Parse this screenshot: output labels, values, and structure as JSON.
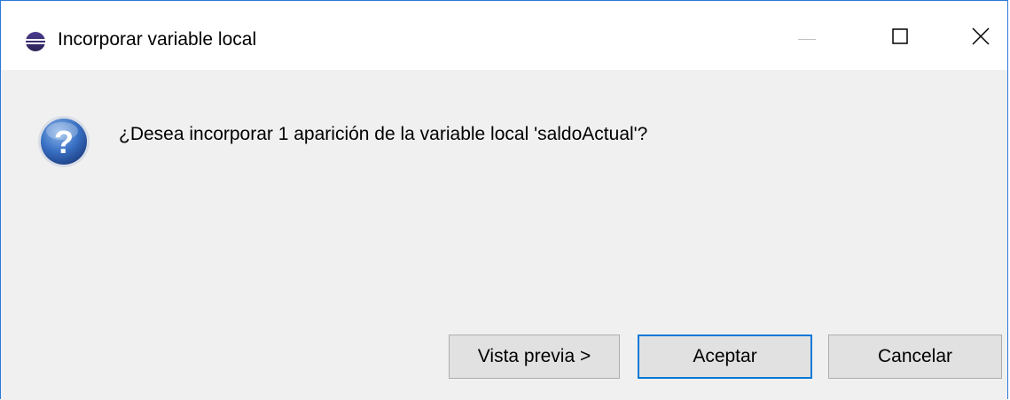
{
  "window": {
    "title": "Incorporar variable local",
    "app_icon": "eclipse-icon",
    "controls": {
      "minimize_icon": "minimize-icon",
      "maximize_icon": "maximize-icon",
      "close_icon": "close-icon"
    }
  },
  "dialog": {
    "icon": "question-icon",
    "message": "¿Desea incorporar 1 aparición de la variable local 'saldoActual'?"
  },
  "buttons": {
    "preview_label": "Vista previa >",
    "ok_label": "Aceptar",
    "cancel_label": "Cancelar"
  },
  "colors": {
    "accent": "#0078d7",
    "window_border": "#2b79d7",
    "dialog_background": "#f0f0f0",
    "button_background": "#e1e1e1"
  }
}
